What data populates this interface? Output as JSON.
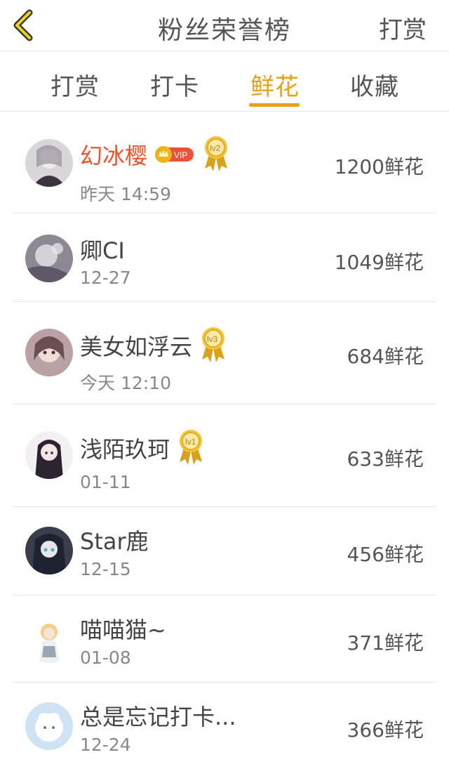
{
  "header": {
    "title": "粉丝荣誉榜",
    "right_label": "打赏"
  },
  "tabs": [
    {
      "label": "打赏"
    },
    {
      "label": "打卡"
    },
    {
      "label": "鲜花"
    },
    {
      "label": "收藏"
    }
  ],
  "active_tab": "鲜花",
  "colors": {
    "accent": "#e7a21b",
    "vip_name": "#e8532a",
    "vip_badge": "#e8533a"
  },
  "badge": {
    "vip_text": "VIP"
  },
  "ranking": [
    {
      "name": "幻冰樱",
      "time": "昨天 14:59",
      "amount": "1200鲜花",
      "vip": true,
      "level": "lv2"
    },
    {
      "name": "卿CI",
      "time": "12-27",
      "amount": "1049鲜花",
      "vip": false,
      "level": ""
    },
    {
      "name": "美女如浮云",
      "time": "今天 12:10",
      "amount": "684鲜花",
      "vip": false,
      "level": "lv3"
    },
    {
      "name": "浅陌玖珂",
      "time": "01-11",
      "amount": "633鲜花",
      "vip": false,
      "level": "lv1"
    },
    {
      "name": "Star鹿",
      "time": "12-15",
      "amount": "456鲜花",
      "vip": false,
      "level": ""
    },
    {
      "name": "喵喵猫~",
      "time": "01-08",
      "amount": "371鲜花",
      "vip": false,
      "level": ""
    },
    {
      "name": "总是忘记打卡...",
      "time": "12-24",
      "amount": "366鲜花",
      "vip": false,
      "level": ""
    }
  ]
}
